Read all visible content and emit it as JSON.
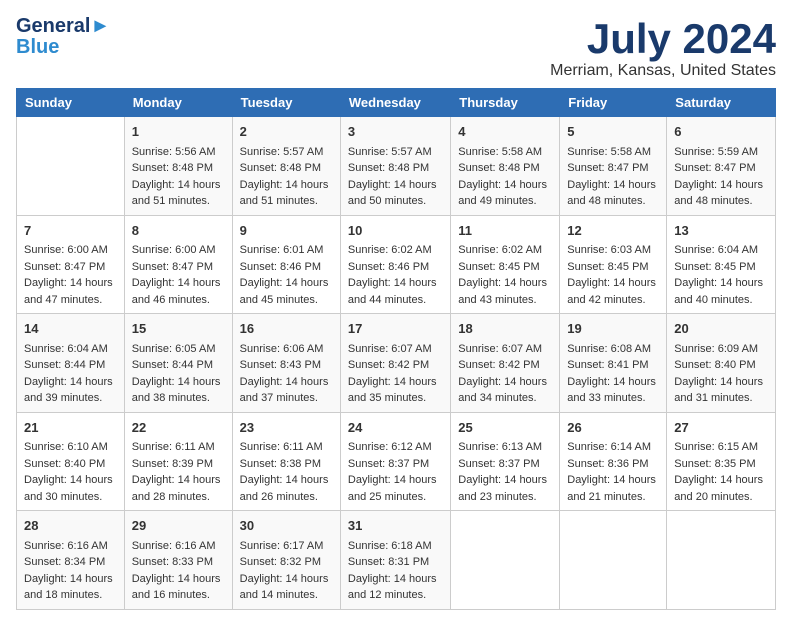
{
  "header": {
    "logo_line1": "General",
    "logo_line2": "Blue",
    "main_title": "July 2024",
    "subtitle": "Merriam, Kansas, United States"
  },
  "weekdays": [
    "Sunday",
    "Monday",
    "Tuesday",
    "Wednesday",
    "Thursday",
    "Friday",
    "Saturday"
  ],
  "weeks": [
    [
      {
        "day": "",
        "empty": true
      },
      {
        "day": "1",
        "sunrise": "Sunrise: 5:56 AM",
        "sunset": "Sunset: 8:48 PM",
        "daylight": "Daylight: 14 hours and 51 minutes."
      },
      {
        "day": "2",
        "sunrise": "Sunrise: 5:57 AM",
        "sunset": "Sunset: 8:48 PM",
        "daylight": "Daylight: 14 hours and 51 minutes."
      },
      {
        "day": "3",
        "sunrise": "Sunrise: 5:57 AM",
        "sunset": "Sunset: 8:48 PM",
        "daylight": "Daylight: 14 hours and 50 minutes."
      },
      {
        "day": "4",
        "sunrise": "Sunrise: 5:58 AM",
        "sunset": "Sunset: 8:48 PM",
        "daylight": "Daylight: 14 hours and 49 minutes."
      },
      {
        "day": "5",
        "sunrise": "Sunrise: 5:58 AM",
        "sunset": "Sunset: 8:47 PM",
        "daylight": "Daylight: 14 hours and 48 minutes."
      },
      {
        "day": "6",
        "sunrise": "Sunrise: 5:59 AM",
        "sunset": "Sunset: 8:47 PM",
        "daylight": "Daylight: 14 hours and 48 minutes."
      }
    ],
    [
      {
        "day": "7",
        "sunrise": "Sunrise: 6:00 AM",
        "sunset": "Sunset: 8:47 PM",
        "daylight": "Daylight: 14 hours and 47 minutes."
      },
      {
        "day": "8",
        "sunrise": "Sunrise: 6:00 AM",
        "sunset": "Sunset: 8:47 PM",
        "daylight": "Daylight: 14 hours and 46 minutes."
      },
      {
        "day": "9",
        "sunrise": "Sunrise: 6:01 AM",
        "sunset": "Sunset: 8:46 PM",
        "daylight": "Daylight: 14 hours and 45 minutes."
      },
      {
        "day": "10",
        "sunrise": "Sunrise: 6:02 AM",
        "sunset": "Sunset: 8:46 PM",
        "daylight": "Daylight: 14 hours and 44 minutes."
      },
      {
        "day": "11",
        "sunrise": "Sunrise: 6:02 AM",
        "sunset": "Sunset: 8:45 PM",
        "daylight": "Daylight: 14 hours and 43 minutes."
      },
      {
        "day": "12",
        "sunrise": "Sunrise: 6:03 AM",
        "sunset": "Sunset: 8:45 PM",
        "daylight": "Daylight: 14 hours and 42 minutes."
      },
      {
        "day": "13",
        "sunrise": "Sunrise: 6:04 AM",
        "sunset": "Sunset: 8:45 PM",
        "daylight": "Daylight: 14 hours and 40 minutes."
      }
    ],
    [
      {
        "day": "14",
        "sunrise": "Sunrise: 6:04 AM",
        "sunset": "Sunset: 8:44 PM",
        "daylight": "Daylight: 14 hours and 39 minutes."
      },
      {
        "day": "15",
        "sunrise": "Sunrise: 6:05 AM",
        "sunset": "Sunset: 8:44 PM",
        "daylight": "Daylight: 14 hours and 38 minutes."
      },
      {
        "day": "16",
        "sunrise": "Sunrise: 6:06 AM",
        "sunset": "Sunset: 8:43 PM",
        "daylight": "Daylight: 14 hours and 37 minutes."
      },
      {
        "day": "17",
        "sunrise": "Sunrise: 6:07 AM",
        "sunset": "Sunset: 8:42 PM",
        "daylight": "Daylight: 14 hours and 35 minutes."
      },
      {
        "day": "18",
        "sunrise": "Sunrise: 6:07 AM",
        "sunset": "Sunset: 8:42 PM",
        "daylight": "Daylight: 14 hours and 34 minutes."
      },
      {
        "day": "19",
        "sunrise": "Sunrise: 6:08 AM",
        "sunset": "Sunset: 8:41 PM",
        "daylight": "Daylight: 14 hours and 33 minutes."
      },
      {
        "day": "20",
        "sunrise": "Sunrise: 6:09 AM",
        "sunset": "Sunset: 8:40 PM",
        "daylight": "Daylight: 14 hours and 31 minutes."
      }
    ],
    [
      {
        "day": "21",
        "sunrise": "Sunrise: 6:10 AM",
        "sunset": "Sunset: 8:40 PM",
        "daylight": "Daylight: 14 hours and 30 minutes."
      },
      {
        "day": "22",
        "sunrise": "Sunrise: 6:11 AM",
        "sunset": "Sunset: 8:39 PM",
        "daylight": "Daylight: 14 hours and 28 minutes."
      },
      {
        "day": "23",
        "sunrise": "Sunrise: 6:11 AM",
        "sunset": "Sunset: 8:38 PM",
        "daylight": "Daylight: 14 hours and 26 minutes."
      },
      {
        "day": "24",
        "sunrise": "Sunrise: 6:12 AM",
        "sunset": "Sunset: 8:37 PM",
        "daylight": "Daylight: 14 hours and 25 minutes."
      },
      {
        "day": "25",
        "sunrise": "Sunrise: 6:13 AM",
        "sunset": "Sunset: 8:37 PM",
        "daylight": "Daylight: 14 hours and 23 minutes."
      },
      {
        "day": "26",
        "sunrise": "Sunrise: 6:14 AM",
        "sunset": "Sunset: 8:36 PM",
        "daylight": "Daylight: 14 hours and 21 minutes."
      },
      {
        "day": "27",
        "sunrise": "Sunrise: 6:15 AM",
        "sunset": "Sunset: 8:35 PM",
        "daylight": "Daylight: 14 hours and 20 minutes."
      }
    ],
    [
      {
        "day": "28",
        "sunrise": "Sunrise: 6:16 AM",
        "sunset": "Sunset: 8:34 PM",
        "daylight": "Daylight: 14 hours and 18 minutes."
      },
      {
        "day": "29",
        "sunrise": "Sunrise: 6:16 AM",
        "sunset": "Sunset: 8:33 PM",
        "daylight": "Daylight: 14 hours and 16 minutes."
      },
      {
        "day": "30",
        "sunrise": "Sunrise: 6:17 AM",
        "sunset": "Sunset: 8:32 PM",
        "daylight": "Daylight: 14 hours and 14 minutes."
      },
      {
        "day": "31",
        "sunrise": "Sunrise: 6:18 AM",
        "sunset": "Sunset: 8:31 PM",
        "daylight": "Daylight: 14 hours and 12 minutes."
      },
      {
        "day": "",
        "empty": true
      },
      {
        "day": "",
        "empty": true
      },
      {
        "day": "",
        "empty": true
      }
    ]
  ]
}
